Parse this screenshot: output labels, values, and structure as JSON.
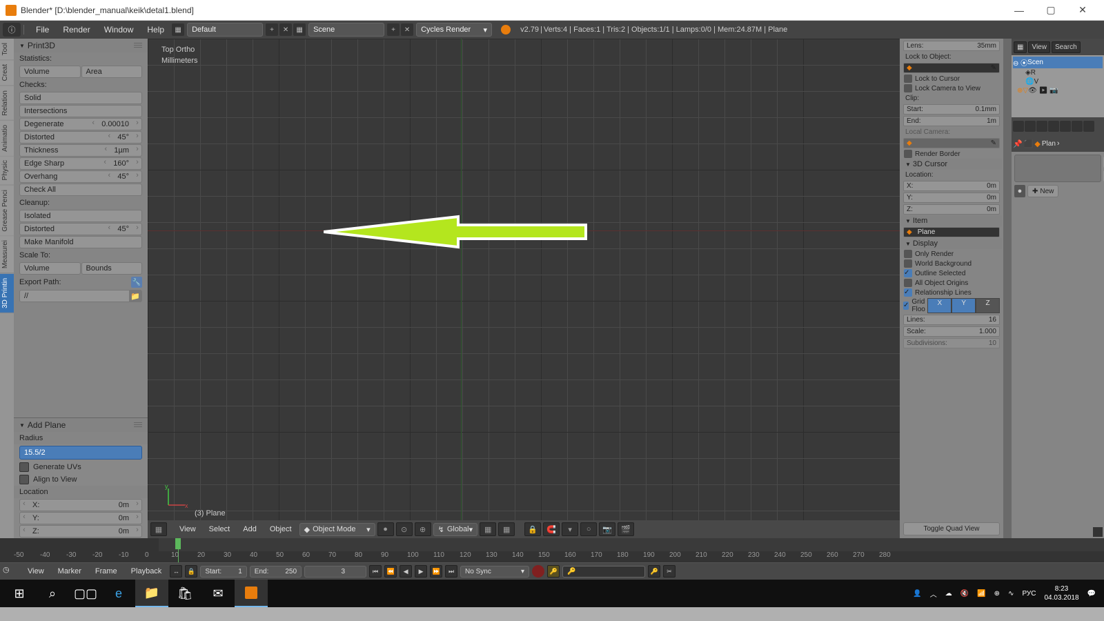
{
  "window": {
    "title": "Blender* [D:\\blender_manual\\keik\\detal1.blend]"
  },
  "menubar": {
    "items": [
      "File",
      "Render",
      "Window",
      "Help"
    ],
    "layout": "Default",
    "scene": "Scene",
    "engine": "Cycles Render",
    "version": "v2.79",
    "stats": "Verts:4 | Faces:1 | Tris:2 | Objects:1/1 | Lamps:0/0 | Mem:24.87M | Plane"
  },
  "vtabs": [
    "Tool",
    "Creat",
    "Relation",
    "Animatio",
    "Physic",
    "Grease Penci",
    "Measurei",
    "3D Printin"
  ],
  "print3d": {
    "title": "Print3D",
    "stats_label": "Statistics:",
    "volume": "Volume",
    "area": "Area",
    "checks_label": "Checks:",
    "solid": "Solid",
    "intersections": "Intersections",
    "degenerate": "Degenerate",
    "degenerate_v": "0.00010",
    "distorted": "Distorted",
    "distorted_v": "45°",
    "thickness": "Thickness",
    "thickness_v": "1µm",
    "edgesharp": "Edge Sharp",
    "edgesharp_v": "160°",
    "overhang": "Overhang",
    "overhang_v": "45°",
    "checkall": "Check All",
    "cleanup_label": "Cleanup:",
    "isolated": "Isolated",
    "distorted2": "Distorted",
    "distorted2_v": "45°",
    "manifold": "Make Manifold",
    "scale_label": "Scale To:",
    "volume2": "Volume",
    "bounds": "Bounds",
    "export_label": "Export Path:",
    "export_path": "//"
  },
  "add_plane": {
    "title": "Add Plane",
    "radius_label": "Radius",
    "radius_value": "15.5/2",
    "gen_uvs": "Generate UVs",
    "align": "Align to View",
    "location_label": "Location",
    "x": "X:",
    "y": "Y:",
    "z": "Z:",
    "zero": "0m"
  },
  "viewport": {
    "view_name": "Top Ortho",
    "units": "Millimeters",
    "object_label": "(3) Plane",
    "footer": {
      "menus": [
        "View",
        "Select",
        "Add",
        "Object"
      ],
      "mode": "Object Mode",
      "orientation": "Global"
    }
  },
  "n_panel": {
    "lens": "Lens:",
    "lens_v": "35mm",
    "lock_obj": "Lock to Object:",
    "lock_cursor": "Lock to Cursor",
    "lock_camera": "Lock Camera to View",
    "clip": "Clip:",
    "start": "Start:",
    "start_v": "0.1mm",
    "end": "End:",
    "end_v": "1m",
    "local_cam": "Local Camera:",
    "render_border": "Render Border",
    "cursor_title": "3D Cursor",
    "loc": "Location:",
    "x": "X:",
    "y": "Y:",
    "z": "Z:",
    "zero": "0m",
    "item_title": "Item",
    "item_name": "Plane",
    "display_title": "Display",
    "only_render": "Only Render",
    "world_bg": "World Background",
    "outline_sel": "Outline Selected",
    "all_origins": "All Object Origins",
    "rel_lines": "Relationship Lines",
    "grid_floor": "Grid Floo",
    "lines": "Lines:",
    "lines_v": "16",
    "scale": "Scale:",
    "scale_v": "1.000",
    "subdiv": "Subdivisions:",
    "subdiv_v": "10",
    "quad": "Toggle Quad View"
  },
  "outliner": {
    "view": "View",
    "search": "Search",
    "scene": "Scen",
    "items": [
      "R",
      "V"
    ],
    "plan": "Plan",
    "new": "New"
  },
  "timeline": {
    "ticks": [
      "-50",
      "-40",
      "-30",
      "-20",
      "-10",
      "0",
      "10",
      "20",
      "30",
      "40",
      "50",
      "60",
      "70",
      "80",
      "90",
      "100",
      "110",
      "120",
      "130",
      "140",
      "150",
      "160",
      "170",
      "180",
      "190",
      "200",
      "210",
      "220",
      "230",
      "240",
      "250",
      "260",
      "270",
      "280"
    ],
    "footer": {
      "menus": [
        "View",
        "Marker",
        "Frame",
        "Playback"
      ],
      "start_l": "Start:",
      "start_v": "1",
      "end_l": "End:",
      "end_v": "250",
      "frame_v": "3",
      "sync": "No Sync"
    }
  },
  "taskbar": {
    "lang": "РУС",
    "time": "8:23",
    "date": "04.03.2018"
  }
}
